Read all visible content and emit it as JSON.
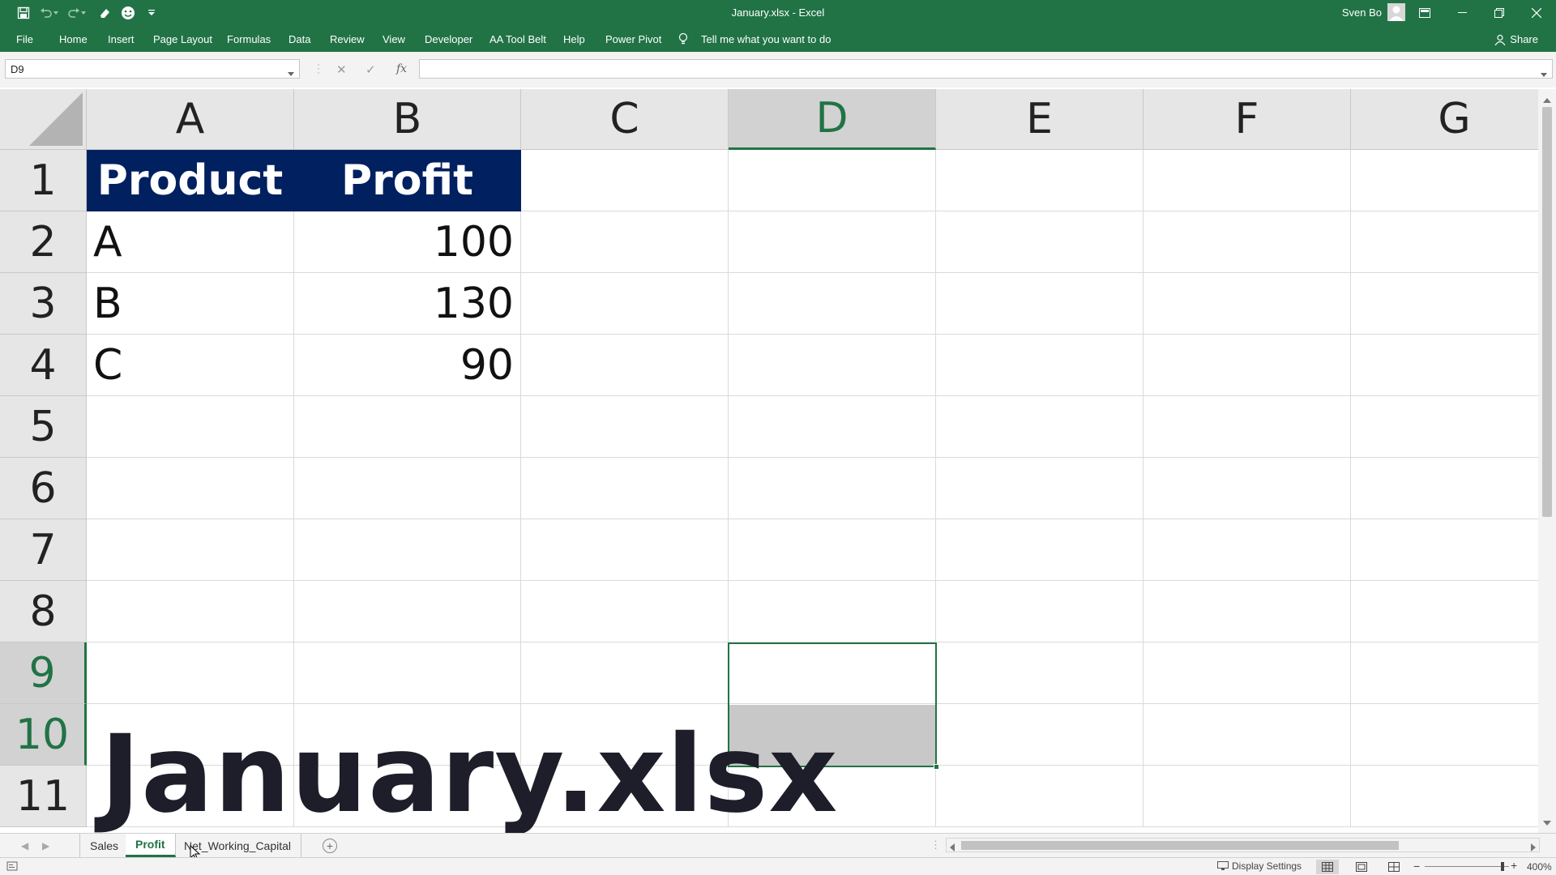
{
  "window": {
    "title": "January.xlsx  -  Excel",
    "user": "Sven Bo"
  },
  "ribbon": {
    "tabs": [
      "File",
      "Home",
      "Insert",
      "Page Layout",
      "Formulas",
      "Data",
      "Review",
      "View",
      "Developer",
      "AA Tool Belt",
      "Help",
      "Power Pivot"
    ],
    "tell_me": "Tell me what you want to do",
    "share": "Share"
  },
  "formula_bar": {
    "name_box": "D9",
    "fx": "fx",
    "value": ""
  },
  "grid": {
    "columns": [
      "A",
      "B",
      "C",
      "D",
      "E",
      "F",
      "G"
    ],
    "rows": [
      "1",
      "2",
      "3",
      "4",
      "5",
      "6",
      "7",
      "8",
      "9",
      "10",
      "11"
    ],
    "selected_column": "D",
    "selected_rows": [
      "9",
      "10"
    ],
    "table": {
      "headers": [
        "Product",
        "Profit"
      ],
      "rows": [
        {
          "product": "A",
          "profit": "100"
        },
        {
          "product": "B",
          "profit": "130"
        },
        {
          "product": "C",
          "profit": "90"
        }
      ]
    },
    "overlay_text": "January.xlsx"
  },
  "sheets": {
    "tabs": [
      "Sales",
      "Profit",
      "Net_Working_Capital"
    ],
    "active": "Profit"
  },
  "status_bar": {
    "display_settings": "Display Settings",
    "zoom": "400%"
  },
  "colors": {
    "excel_green": "#217346",
    "header_fill": "#002060"
  }
}
